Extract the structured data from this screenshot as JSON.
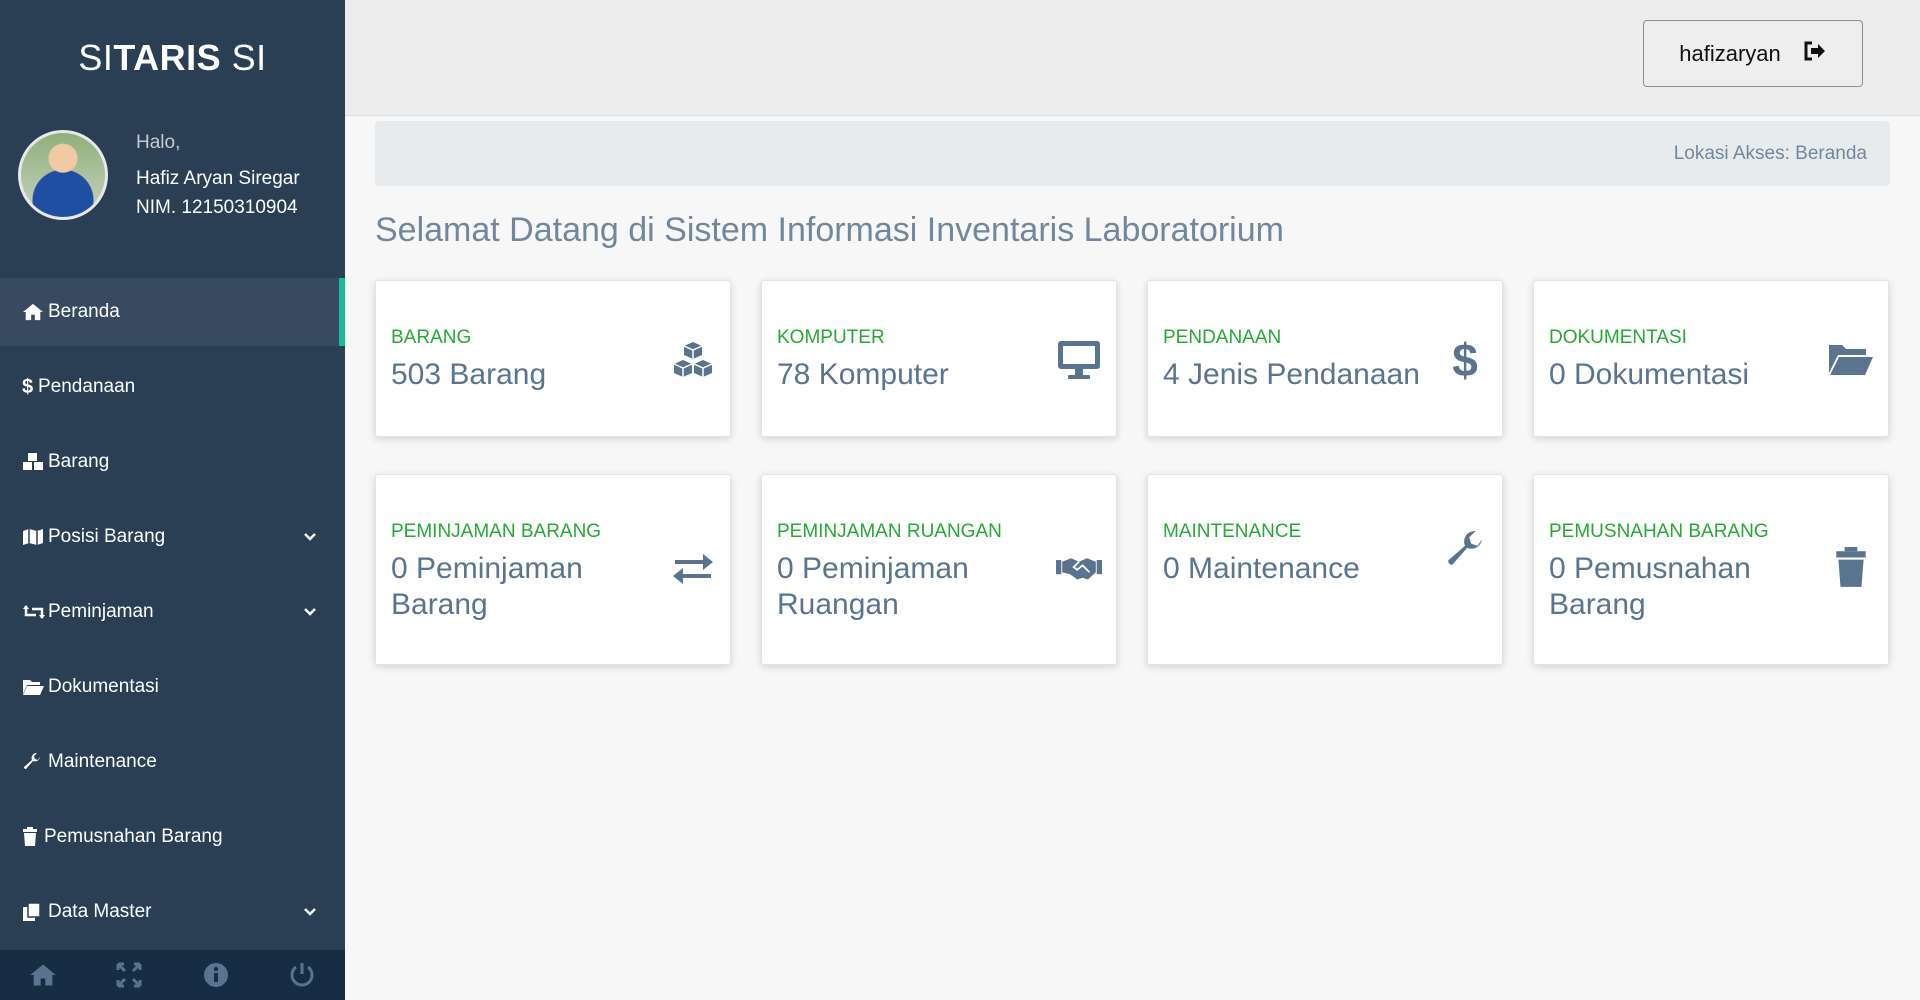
{
  "app": {
    "brand_light": "SI",
    "brand_bold": "TARIS",
    "brand_suffix": "SI"
  },
  "profile": {
    "greeting": "Halo,",
    "name": "Hafiz Aryan Siregar",
    "nim": "NIM. 12150310904"
  },
  "sidebar": {
    "items": [
      {
        "label": "Beranda",
        "icon": "home-icon",
        "active": true
      },
      {
        "label": "Pendanaan",
        "icon": "dollar-icon"
      },
      {
        "label": "Barang",
        "icon": "cubes-icon"
      },
      {
        "label": "Posisi Barang",
        "icon": "map-icon",
        "has_submenu": true
      },
      {
        "label": "Peminjaman",
        "icon": "retweet-icon",
        "has_submenu": true
      },
      {
        "label": "Dokumentasi",
        "icon": "folder-open-icon"
      },
      {
        "label": "Maintenance",
        "icon": "wrench-icon"
      },
      {
        "label": "Pemusnahan Barang",
        "icon": "trash-icon"
      },
      {
        "label": "Data Master",
        "icon": "copy-icon",
        "has_submenu": true
      }
    ],
    "footer_icons": [
      "home-icon",
      "fullscreen-icon",
      "info-icon",
      "power-icon"
    ]
  },
  "topbar": {
    "username": "hafizaryan",
    "icon": "sign-out-icon"
  },
  "breadcrumb": {
    "text": "Lokasi Akses: Beranda"
  },
  "page_title": "Selamat Datang di Sistem Informasi Inventaris Laboratorium",
  "cards": [
    {
      "label": "BARANG",
      "value": "503 Barang",
      "icon": "cubes-icon"
    },
    {
      "label": "KOMPUTER",
      "value": "78 Komputer",
      "icon": "desktop-icon"
    },
    {
      "label": "PENDANAAN",
      "value": "4 Jenis Pendanaan",
      "icon": "dollar-icon"
    },
    {
      "label": "DOKUMENTASI",
      "value": "0 Dokumentasi",
      "icon": "folder-open-icon"
    },
    {
      "label": "PEMINJAMAN BARANG",
      "value": "0 Peminjaman Barang",
      "icon": "exchange-icon"
    },
    {
      "label": "PEMINJAMAN RUANGAN",
      "value": "0 Peminjaman Ruangan",
      "icon": "handshake-icon"
    },
    {
      "label": "MAINTENANCE",
      "value": "0 Maintenance",
      "icon": "wrench-icon"
    },
    {
      "label": "PEMUSNAHAN BARANG",
      "value": "0 Pemusnahan Barang",
      "icon": "trash-icon"
    }
  ],
  "colors": {
    "sidebar_bg": "#2a3f54",
    "accent": "#1abb9c",
    "card_label": "#26a836",
    "card_value": "#5a738e"
  }
}
